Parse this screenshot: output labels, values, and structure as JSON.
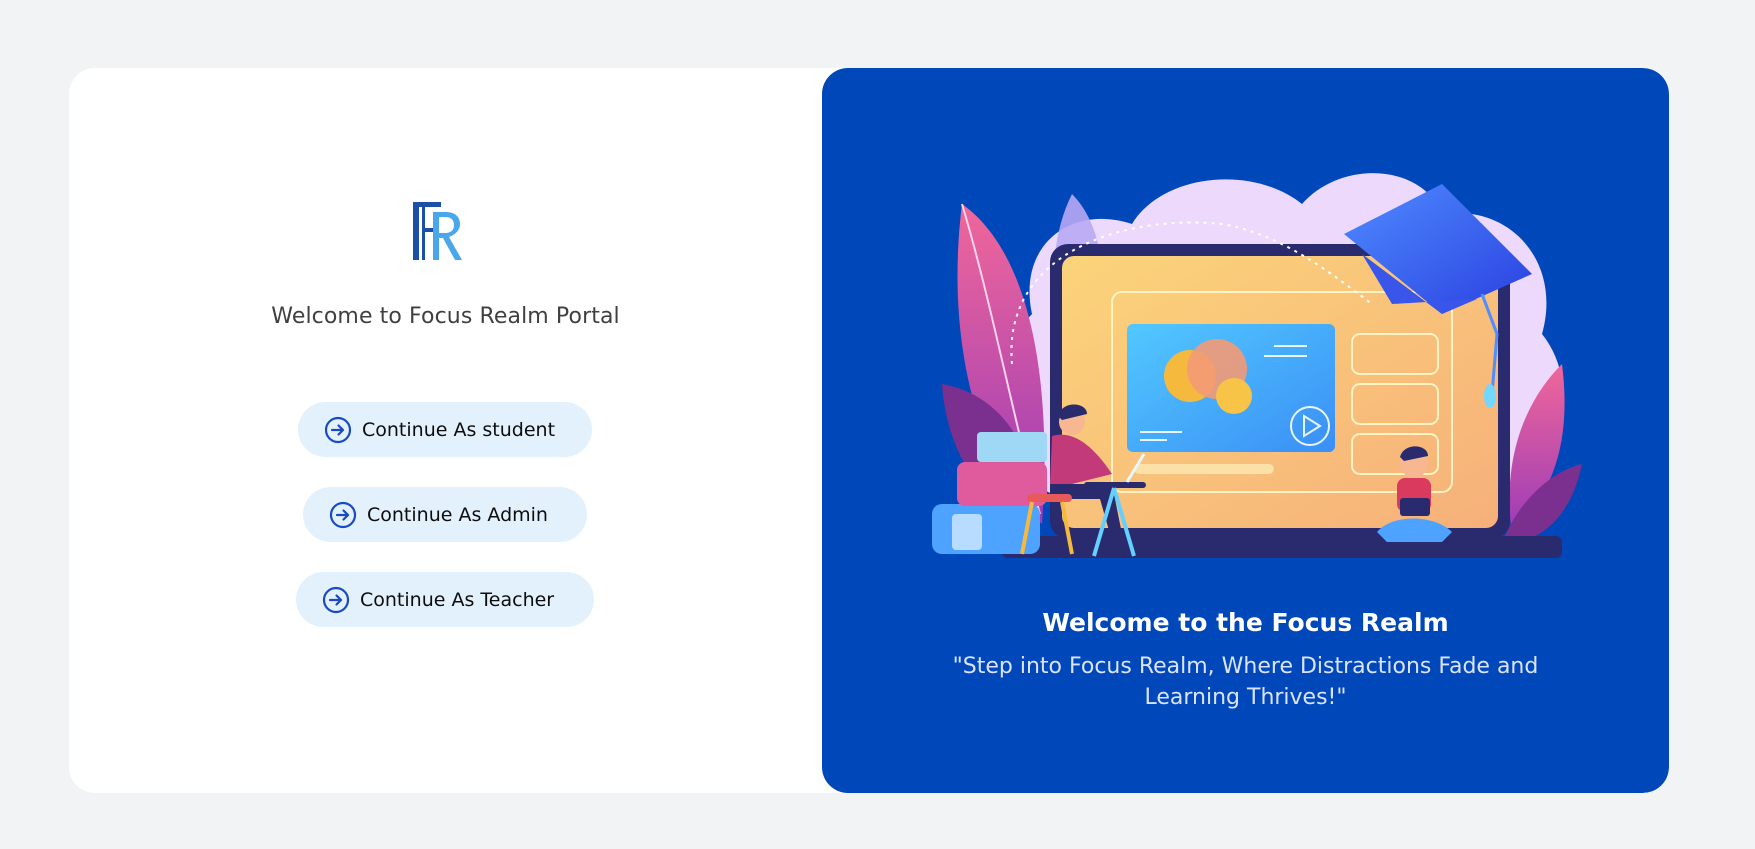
{
  "portal": {
    "welcome_text": "Welcome to Focus Realm Portal",
    "logo_letters": "FR",
    "buttons": {
      "student": "Continue As student",
      "admin": "Continue As Admin",
      "teacher": "Continue As Teacher"
    }
  },
  "hero": {
    "title": "Welcome to the Focus Realm",
    "quote": "\"Step into Focus Realm, Where Distractions Fade and Learning Thrives!\""
  },
  "icons": {
    "logo": "fr-logo-icon",
    "button": "circle-arrow-right-icon",
    "illustration": "online-learning-illustration"
  },
  "colors": {
    "page_bg": "#f2f3f5",
    "card_bg": "#ffffff",
    "hero_bg": "#0048b9",
    "button_bg": "#e3f1fd",
    "accent": "#1a49c4"
  }
}
